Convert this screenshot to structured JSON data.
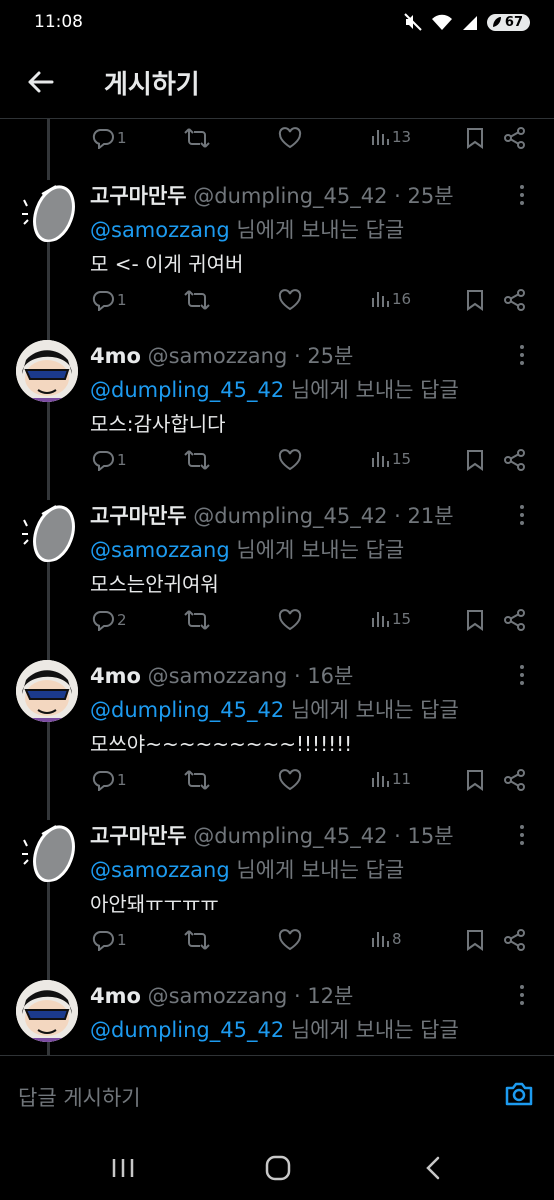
{
  "status_bar": {
    "time": "11:08",
    "battery": "67"
  },
  "header": {
    "title": "게시하기"
  },
  "top_actions": {
    "reply_count": "1",
    "view_count": "13"
  },
  "tweets": [
    {
      "author": "goguma",
      "name": "고구마만두",
      "handle": "@dumpling_45_42",
      "time": "25분",
      "reply_to_prefix": "",
      "mention": "@samozzang",
      "reply_to_suffix": " 님에게 보내는 답글",
      "text": "모 <- 이게 귀여버",
      "reply_count": "1",
      "view_count": "16"
    },
    {
      "author": "4mo",
      "name": "4mo",
      "handle": "@samozzang",
      "time": "25분",
      "mention": "@dumpling_45_42",
      "reply_to_suffix": " 님에게 보내는 답글",
      "text": "모스:감사합니다",
      "reply_count": "1",
      "view_count": "15"
    },
    {
      "author": "goguma",
      "name": "고구마만두",
      "handle": "@dumpling_45_42",
      "time": "21분",
      "mention": "@samozzang",
      "reply_to_suffix": " 님에게 보내는 답글",
      "text": "모스는안귀여워",
      "reply_count": "2",
      "view_count": "15"
    },
    {
      "author": "4mo",
      "name": "4mo",
      "handle": "@samozzang",
      "time": "16분",
      "mention": "@dumpling_45_42",
      "reply_to_suffix": " 님에게 보내는 답글",
      "text": "모쓰야~~~~~~~~~!!!!!!!",
      "reply_count": "1",
      "view_count": "11"
    },
    {
      "author": "goguma",
      "name": "고구마만두",
      "handle": "@dumpling_45_42",
      "time": "15분",
      "mention": "@samozzang",
      "reply_to_suffix": " 님에게 보내는 답글",
      "text": "아안돼ㅠㅜㅠㅠ",
      "reply_count": "1",
      "view_count": "8"
    },
    {
      "author": "4mo",
      "name": "4mo",
      "handle": "@samozzang",
      "time": "12분",
      "mention": "@dumpling_45_42",
      "reply_to_suffix": " 님에게 보내는 답글",
      "text": "",
      "reply_count": "",
      "view_count": ""
    }
  ],
  "separator": " · ",
  "reply_bar": {
    "placeholder": "답글 게시하기"
  },
  "colors": {
    "background": "#000000",
    "text": "#e7e9ea",
    "muted": "#71767b",
    "accent": "#1d9bf0"
  }
}
